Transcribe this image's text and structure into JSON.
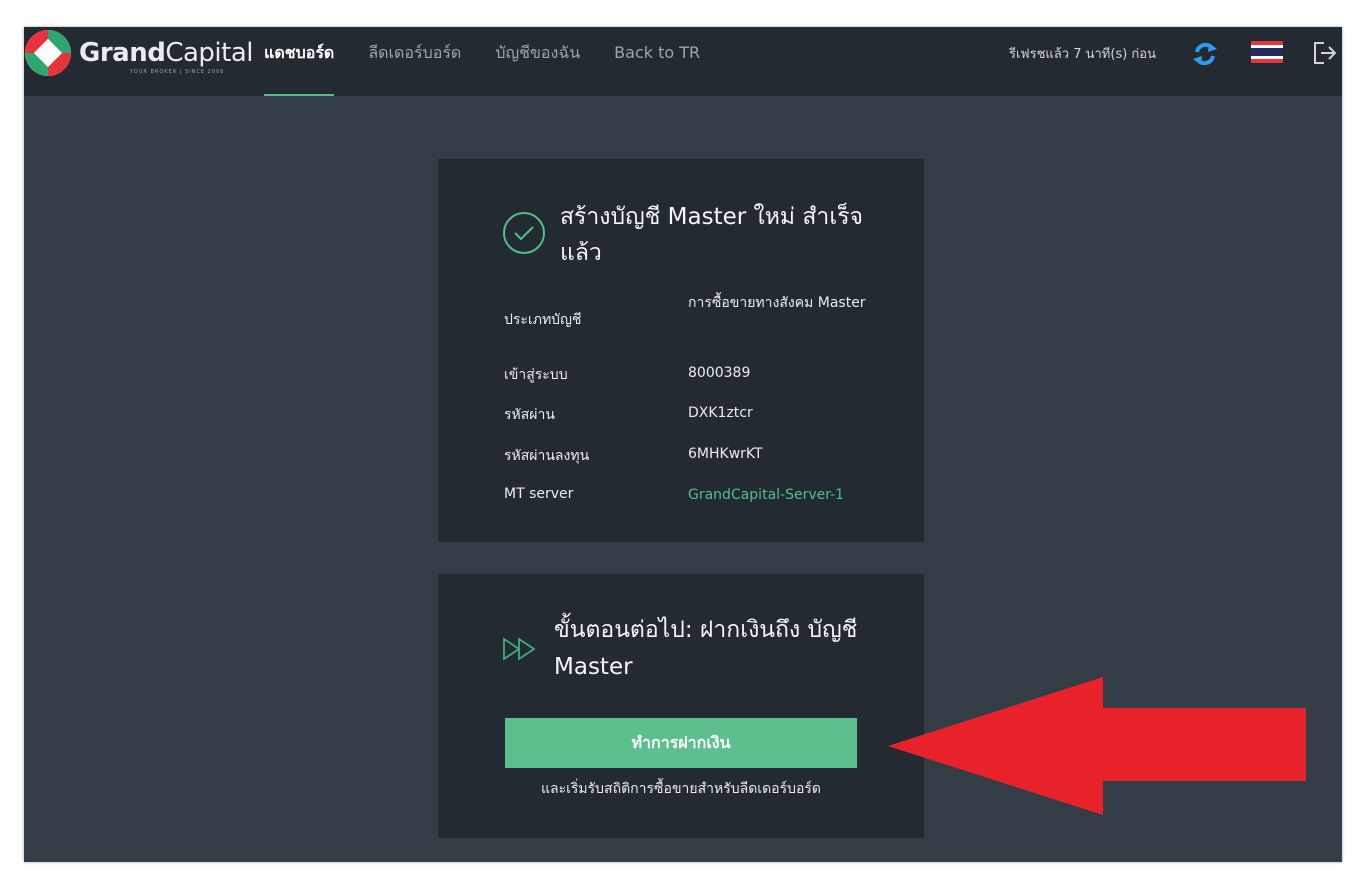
{
  "brand": {
    "name_bold": "Grand",
    "name_regular": "Capital",
    "tagline": "YOUR BROKER  |  SINCE 2006"
  },
  "nav": {
    "items": [
      {
        "label": "แดชบอร์ด",
        "active": true
      },
      {
        "label": "ลีดเดอร์บอร์ด",
        "active": false
      },
      {
        "label": "บัญชีของฉัน",
        "active": false
      },
      {
        "label": "Back to TR",
        "active": false
      }
    ]
  },
  "header": {
    "refresh_status": "รีเฟรชแล้ว 7 นาที(s) ก่อน",
    "refresh_icon": "refresh-icon",
    "language_flag": "thailand-flag-icon",
    "logout_icon": "logout-icon"
  },
  "success_card": {
    "title": "สร้างบัญชี Master ใหม่ สำเร็จแล้ว",
    "icon": "check-circle-icon",
    "fields": [
      {
        "label": "ประเภทบัญชี",
        "value": "การซื้อขายทางสังคม Master"
      },
      {
        "label": "เข้าสู่ระบบ",
        "value": "8000389"
      },
      {
        "label": "รหัสผ่าน",
        "value": "DXK1ztcr"
      },
      {
        "label": "รหัสผ่านลงทุน",
        "value": "6MHKwrKT"
      },
      {
        "label": "MT server",
        "value": "GrandCapital-Server-1"
      }
    ]
  },
  "next_step_card": {
    "icon": "fast-forward-icon",
    "title": "ขั้นตอนต่อไป: ฝากเงินถึง บัญชี Master",
    "button_label": "ทำการฝากเงิน",
    "note": "และเริ่มรับสถิติการซื้อขายสำหรับลีดเดอร์บอร์ด"
  },
  "annotation": {
    "arrow_icon": "red-arrow-left-icon"
  },
  "colors": {
    "background": "#343c45",
    "panel": "#232a31",
    "accent": "#5cbf8d",
    "arrow": "#e8222b"
  }
}
